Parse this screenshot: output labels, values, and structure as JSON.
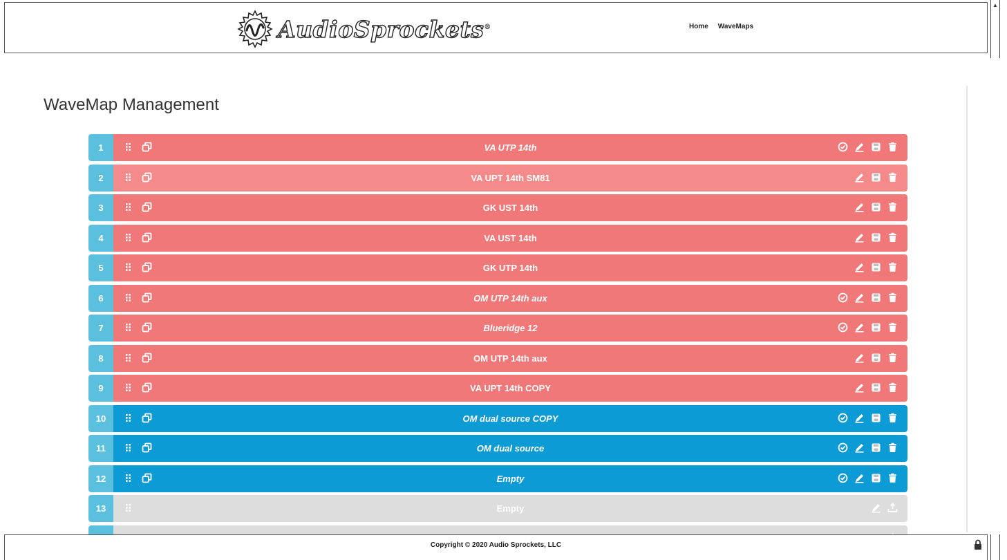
{
  "header": {
    "logo_text": "AudioSprockets",
    "logo_reg": "®",
    "nav": [
      "Home",
      "WaveMaps"
    ]
  },
  "page_title": "WaveMap Management",
  "rows": [
    {
      "num": "1",
      "name": "VA UTP 14th",
      "style": "red",
      "italic": true,
      "icons": [
        "check-circle-icon",
        "pencil-icon",
        "save-icon",
        "trash-icon"
      ]
    },
    {
      "num": "2",
      "name": "VA UPT 14th SM81",
      "style": "red light",
      "italic": false,
      "icons": [
        "pencil-icon",
        "save-icon",
        "trash-icon"
      ]
    },
    {
      "num": "3",
      "name": "GK UST 14th",
      "style": "red",
      "italic": false,
      "icons": [
        "pencil-icon",
        "save-icon",
        "trash-icon"
      ]
    },
    {
      "num": "4",
      "name": "VA UST 14th",
      "style": "red",
      "italic": false,
      "icons": [
        "pencil-icon",
        "save-icon",
        "trash-icon"
      ]
    },
    {
      "num": "5",
      "name": "GK UTP 14th",
      "style": "red",
      "italic": false,
      "icons": [
        "pencil-icon",
        "save-icon",
        "trash-icon"
      ]
    },
    {
      "num": "6",
      "name": "OM UTP 14th aux",
      "style": "red",
      "italic": true,
      "icons": [
        "check-circle-icon",
        "pencil-icon",
        "save-icon",
        "trash-icon"
      ]
    },
    {
      "num": "7",
      "name": "Blueridge 12",
      "style": "red",
      "italic": true,
      "icons": [
        "check-circle-icon",
        "pencil-icon",
        "save-icon",
        "trash-icon"
      ]
    },
    {
      "num": "8",
      "name": "OM UTP 14th aux",
      "style": "red",
      "italic": false,
      "icons": [
        "pencil-icon",
        "save-icon",
        "trash-icon"
      ]
    },
    {
      "num": "9",
      "name": "VA UPT 14th COPY",
      "style": "red",
      "italic": false,
      "icons": [
        "pencil-icon",
        "save-icon",
        "trash-icon"
      ]
    },
    {
      "num": "10",
      "name": "OM dual source COPY",
      "style": "blue",
      "italic": true,
      "icons": [
        "check-circle-icon",
        "pencil-icon",
        "save-icon",
        "trash-icon"
      ]
    },
    {
      "num": "11",
      "name": "OM dual source",
      "style": "blue",
      "italic": true,
      "icons": [
        "check-circle-icon",
        "pencil-icon",
        "save-icon",
        "trash-icon"
      ]
    },
    {
      "num": "12",
      "name": "Empty",
      "style": "blue",
      "italic": true,
      "icons": [
        "check-circle-icon",
        "pencil-icon",
        "save-icon",
        "trash-icon"
      ]
    },
    {
      "num": "13",
      "name": "Empty",
      "style": "gray",
      "italic": false,
      "icons": [
        "pencil-icon",
        "upload-icon"
      ]
    },
    {
      "num": "",
      "name": "",
      "style": "gray",
      "italic": false,
      "icons": [
        "pencil-icon",
        "upload-icon"
      ]
    }
  ],
  "footer": {
    "copyright": "Copyright © 2020 Audio Sprockets, LLC"
  },
  "colors": {
    "red": "#f07878",
    "red_light": "#f48a8a",
    "blue": "#0d9bd6",
    "gray": "#dddddd",
    "number_cell": "#5bc0de"
  }
}
